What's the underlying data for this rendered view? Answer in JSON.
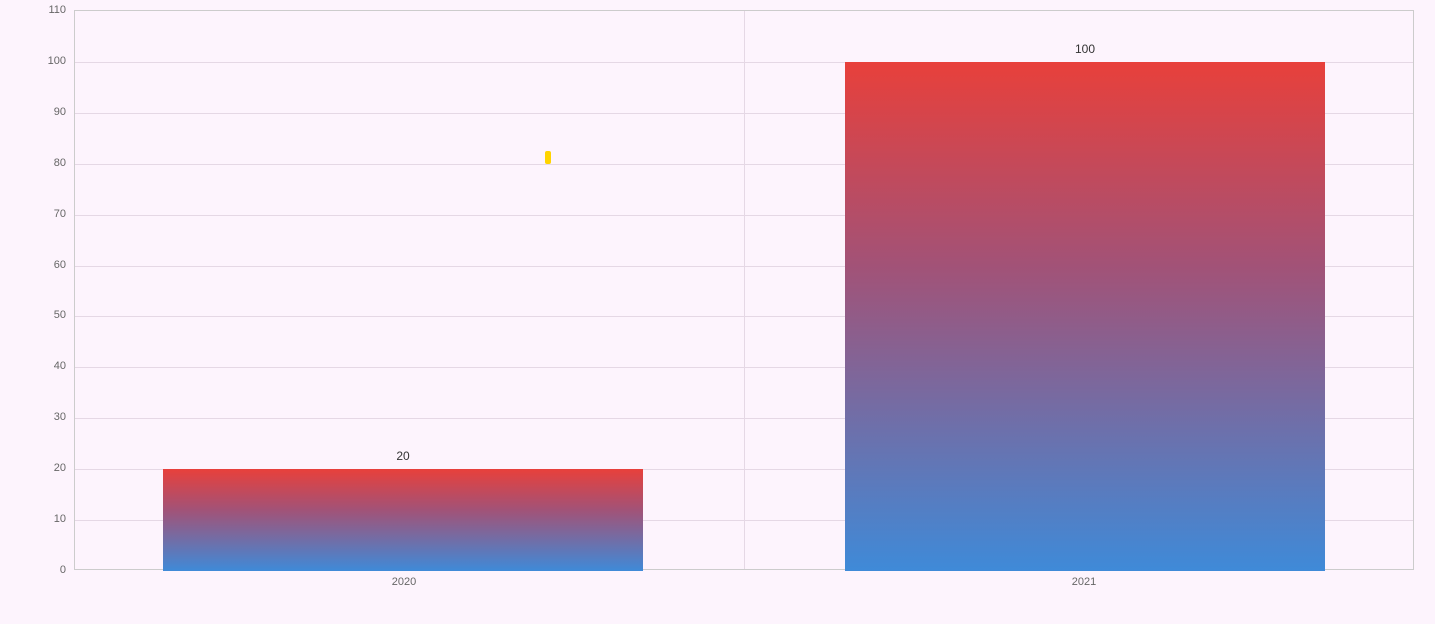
{
  "chart_data": {
    "type": "bar",
    "categories": [
      "2020",
      "2021"
    ],
    "values": [
      20,
      100
    ],
    "value_labels": [
      "20",
      "100"
    ],
    "ylim": [
      0,
      110
    ],
    "y_ticks": [
      0,
      10,
      20,
      30,
      40,
      50,
      60,
      70,
      80,
      90,
      100,
      110
    ],
    "gradient_top": "#e8403b",
    "gradient_bottom": "#3f8ad8",
    "marker_color": "#ffd400",
    "title": "",
    "xlabel": "",
    "ylabel": ""
  }
}
